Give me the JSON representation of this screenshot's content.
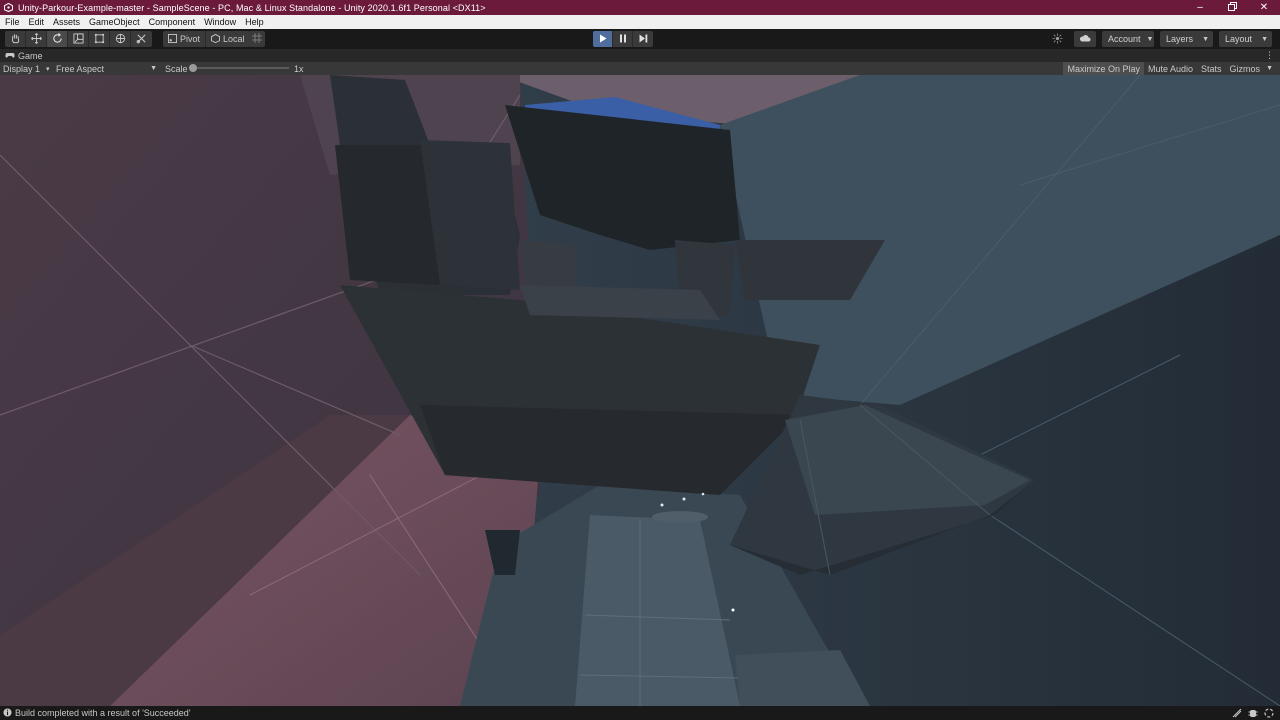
{
  "window": {
    "title": "Unity-Parkour-Example-master - SampleScene - PC, Mac & Linux Standalone - Unity 2020.1.6f1 Personal <DX11>",
    "controls": [
      "minimize-icon",
      "restore-icon",
      "close-icon"
    ]
  },
  "menu": {
    "items": [
      "File",
      "Edit",
      "Assets",
      "GameObject",
      "Component",
      "Window",
      "Help"
    ]
  },
  "toolbar": {
    "tools": [
      "hand-tool-icon",
      "move-tool-icon",
      "rotate-tool-icon",
      "scale-tool-icon",
      "rect-tool-icon",
      "transform-tool-icon",
      "custom-tool-icon"
    ],
    "active_tool": "rotate-tool-icon",
    "pivot_label": "Pivot",
    "local_label": "Local",
    "grid_snap_icon": "grid-snap-icon",
    "play_state": "playing",
    "collab_icon": "collab-icon",
    "cloud_icon": "cloud-icon",
    "account_label": "Account",
    "layers_label": "Layers",
    "layout_label": "Layout"
  },
  "game_tab": {
    "label": "Game",
    "menu_icon": "kebab-menu-icon"
  },
  "game_bar": {
    "display": "Display 1",
    "aspect": "Free Aspect",
    "scale_label": "Scale",
    "scale_value": "1x",
    "maximize_on_play": "Maximize On Play",
    "mute_audio": "Mute Audio",
    "stats": "Stats",
    "gizmos": "Gizmos"
  },
  "status": {
    "message": "Build completed with a result of 'Succeeded'"
  },
  "colors": {
    "title_bar": "#6b1a3c",
    "play_active": "#4f6e9e",
    "viewport_sky": "#3b5fa6"
  }
}
